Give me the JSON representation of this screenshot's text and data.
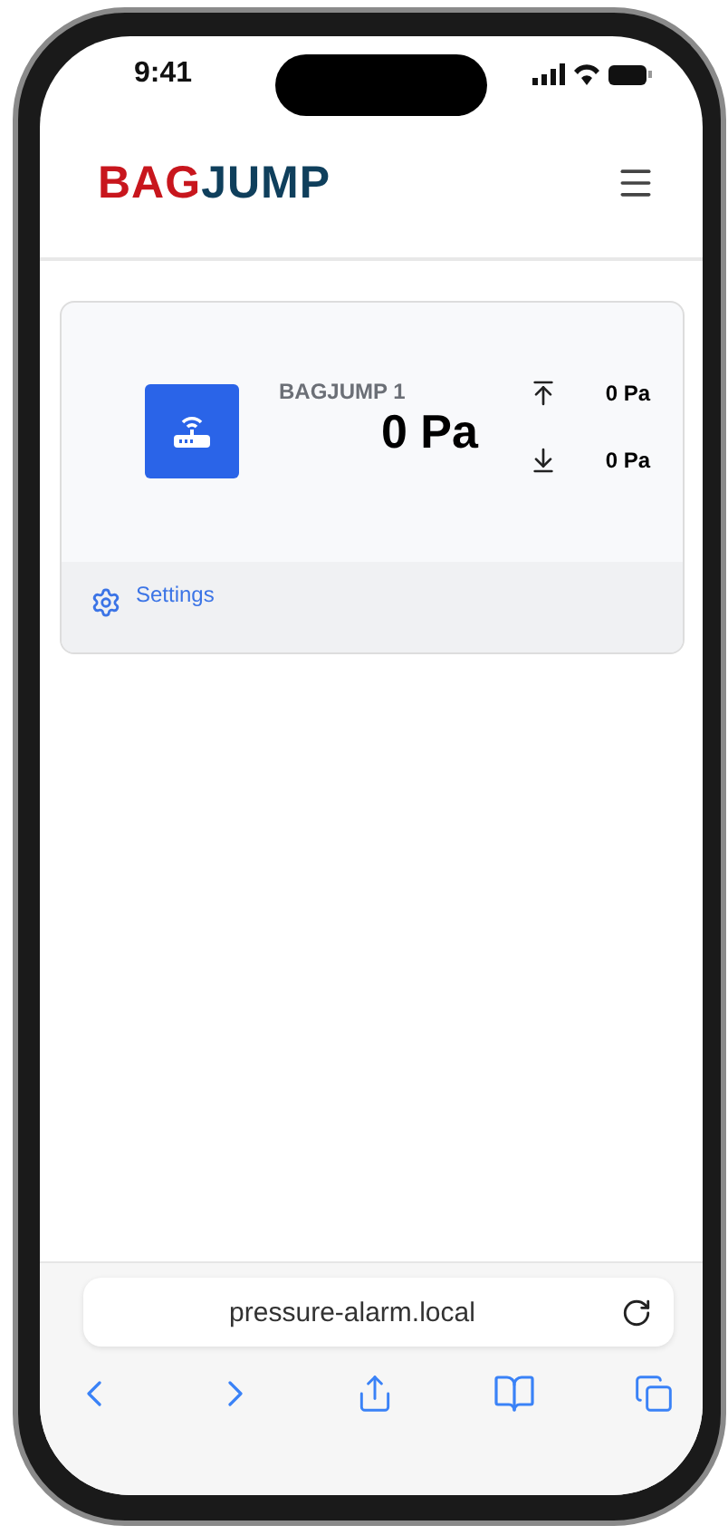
{
  "status_bar": {
    "time": "9:41"
  },
  "header": {
    "logo": [
      "BAG",
      "JUMP"
    ]
  },
  "device_card": {
    "name": "BAGJUMP 1",
    "value": "0 Pa",
    "max": "0 Pa",
    "min": "0 Pa",
    "settings_link": "Settings"
  },
  "browser": {
    "url": "pressure-alarm.local"
  }
}
